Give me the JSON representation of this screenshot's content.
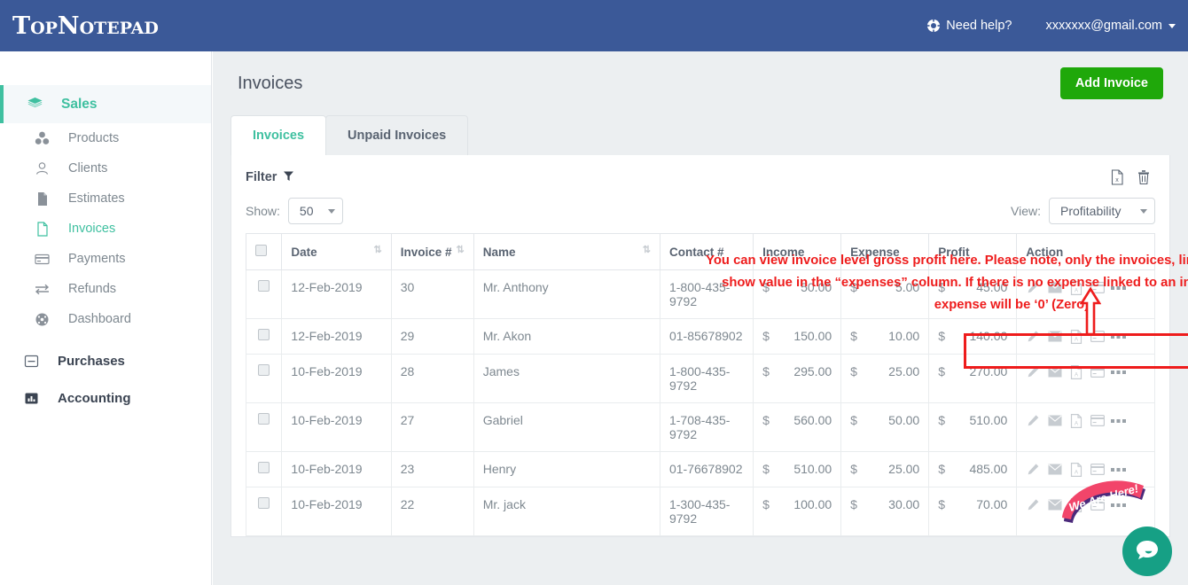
{
  "header": {
    "logo": "TopNotepad",
    "need_help": "Need help?",
    "user_email": "xxxxxxx@gmail.com"
  },
  "sidebar": {
    "group": {
      "label": "Sales",
      "icon": "layers-icon"
    },
    "items": [
      {
        "label": "Products",
        "icon": "cubes-icon",
        "active": false
      },
      {
        "label": "Clients",
        "icon": "user-icon",
        "active": false
      },
      {
        "label": "Estimates",
        "icon": "file-icon",
        "active": false
      },
      {
        "label": "Invoices",
        "icon": "file-text-icon",
        "active": true
      },
      {
        "label": "Payments",
        "icon": "credit-card-icon",
        "active": false
      },
      {
        "label": "Refunds",
        "icon": "exchange-icon",
        "active": false
      },
      {
        "label": "Dashboard",
        "icon": "gauge-icon",
        "active": false
      }
    ],
    "sections": [
      {
        "label": "Purchases",
        "icon": "minus-box-icon"
      },
      {
        "label": "Accounting",
        "icon": "bar-chart-icon"
      }
    ]
  },
  "page": {
    "title": "Invoices",
    "add_button": "Add Invoice",
    "tabs": [
      {
        "label": "Invoices",
        "active": true
      },
      {
        "label": "Unpaid Invoices",
        "active": false
      }
    ]
  },
  "toolbar": {
    "filter_label": "Filter",
    "filter_icon": "funnel-icon",
    "export_excel_icon": "excel-export-icon",
    "delete_icon": "trash-icon",
    "show_label": "Show:",
    "show_value": "50",
    "view_label": "View:",
    "view_value": "Profitability"
  },
  "table": {
    "columns": [
      {
        "key": "checkbox",
        "label": "",
        "sortable": false
      },
      {
        "key": "date",
        "label": "Date",
        "sortable": true
      },
      {
        "key": "invoice",
        "label": "Invoice #",
        "sortable": true
      },
      {
        "key": "name",
        "label": "Name",
        "sortable": true
      },
      {
        "key": "contact",
        "label": "Contact #",
        "sortable": false
      },
      {
        "key": "income",
        "label": "Income",
        "sortable": false
      },
      {
        "key": "expense",
        "label": "Expense",
        "sortable": false
      },
      {
        "key": "profit",
        "label": "Profit",
        "sortable": false
      },
      {
        "key": "action",
        "label": "Action",
        "sortable": false
      }
    ],
    "currency": "$",
    "rows": [
      {
        "date": "12-Feb-2019",
        "invoice": "30",
        "name": "Mr. Anthony",
        "contact": "1-800-435-9792",
        "income": "50.00",
        "expense": "5.00",
        "profit": "45.00"
      },
      {
        "date": "12-Feb-2019",
        "invoice": "29",
        "name": "Mr. Akon",
        "contact": "01-85678902",
        "income": "150.00",
        "expense": "10.00",
        "profit": "140.00"
      },
      {
        "date": "10-Feb-2019",
        "invoice": "28",
        "name": "James",
        "contact": "1-800-435-9792",
        "income": "295.00",
        "expense": "25.00",
        "profit": "270.00"
      },
      {
        "date": "10-Feb-2019",
        "invoice": "27",
        "name": "Gabriel",
        "contact": "1-708-435-9792",
        "income": "560.00",
        "expense": "50.00",
        "profit": "510.00"
      },
      {
        "date": "10-Feb-2019",
        "invoice": "23",
        "name": "Henry",
        "contact": "01-76678902",
        "income": "510.00",
        "expense": "25.00",
        "profit": "485.00"
      },
      {
        "date": "10-Feb-2019",
        "invoice": "22",
        "name": "Mr. jack",
        "contact": "1-300-435-9792",
        "income": "100.00",
        "expense": "30.00",
        "profit": "70.00"
      }
    ],
    "row_action_icons": [
      "edit-pencil-icon",
      "envelope-icon",
      "pdf-icon",
      "credit-card-icon",
      "more-ellipsis-icon"
    ]
  },
  "annotation": {
    "text": "You can view invoice level gross profit here. Please note, only the invoices, linked to expenses will show value in the “expenses” column. If there is no expense linked to an invoice, the value of expense will be ‘0’ (Zero).",
    "color": "#ee1c1c"
  },
  "widgets": {
    "we_are_here": "We Are Here!",
    "chat_icon": "chat-bubble-icon"
  },
  "colors": {
    "header_blue": "#3b5998",
    "accent_teal": "#3fc0a0",
    "add_green": "#1fa80a",
    "annotation_red": "#ee1c1c",
    "chat_teal": "#16a085",
    "badge_pink": "#f2456a"
  }
}
